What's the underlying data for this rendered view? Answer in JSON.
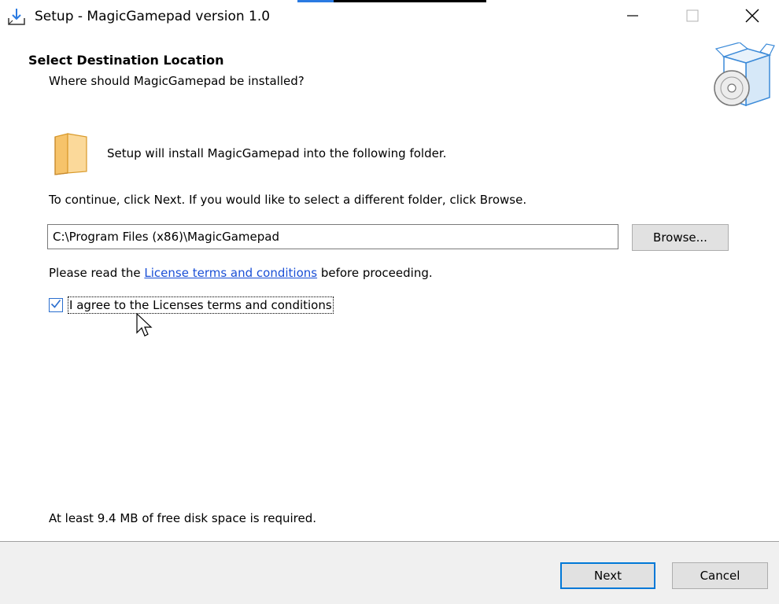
{
  "window": {
    "title": "Setup - MagicGamepad version 1.0"
  },
  "header": {
    "title": "Select Destination Location",
    "subtitle": "Where should MagicGamepad be installed?"
  },
  "body": {
    "setup_text": "Setup will install MagicGamepad into the following folder.",
    "continue_text": "To continue, click Next. If you would like to select a different folder, click Browse.",
    "path_value": "C:\\Program Files (x86)\\MagicGamepad",
    "browse_label": "Browse...",
    "license_prefix": "Please read the ",
    "license_link": "License terms and conditions",
    "license_suffix": " before proceeding.",
    "agree_label": "I agree to the Licenses terms and conditions",
    "agree_checked": true,
    "disk_space": "At least 9.4 MB of free disk space is required."
  },
  "footer": {
    "next_label": "Next",
    "cancel_label": "Cancel"
  },
  "colors": {
    "accent": "#0078d7",
    "link": "#1a4fd6",
    "footer_bg": "#f0f0f0"
  },
  "icons": [
    "setup-download-icon",
    "minimize-icon",
    "maximize-icon",
    "close-icon",
    "installer-box-icon",
    "folder-icon",
    "checkmark-icon",
    "mouse-cursor-icon"
  ]
}
